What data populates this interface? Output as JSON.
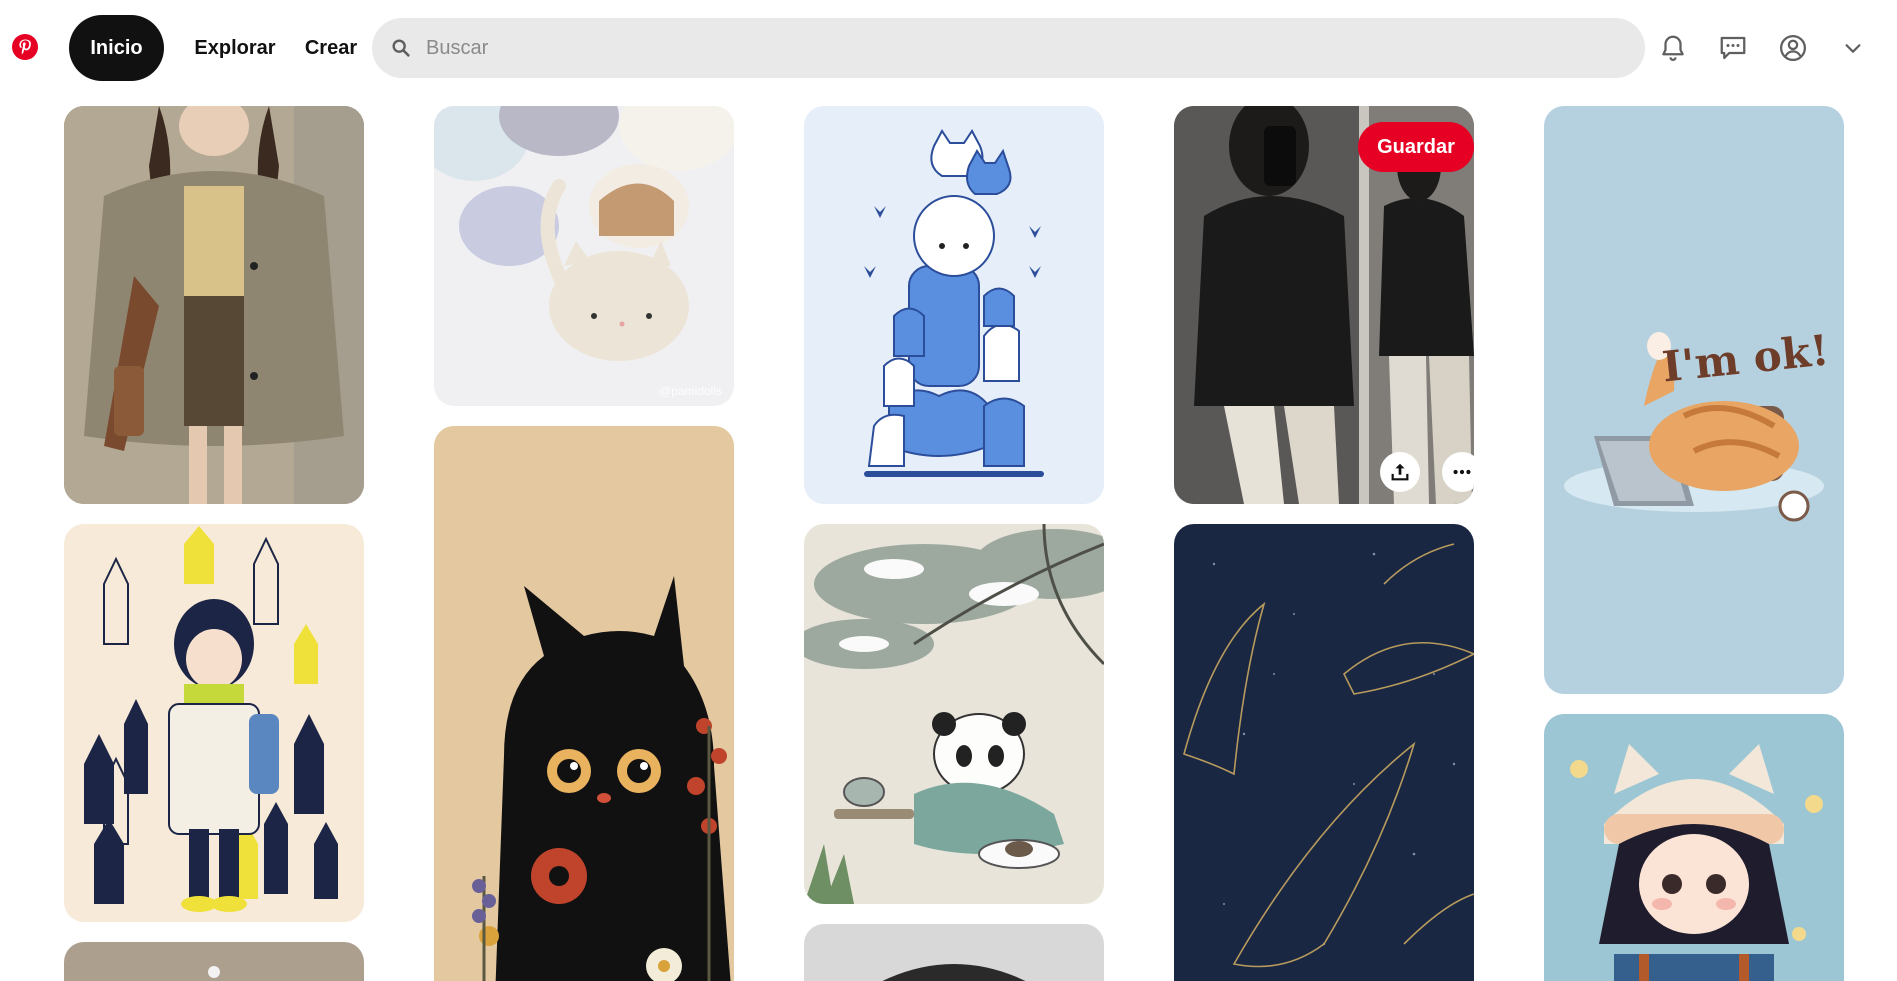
{
  "app": {
    "brand": "Pinterest",
    "accent_color": "#e60023"
  },
  "header": {
    "nav": {
      "home": "Inicio",
      "explore": "Explorar",
      "create": "Crear"
    },
    "search": {
      "placeholder": "Buscar"
    },
    "icons": [
      "pinterest-logo-icon",
      "search-icon",
      "bell-icon",
      "messages-icon",
      "account-icon",
      "chevron-down-icon"
    ]
  },
  "feed": {
    "save_label": "Guardar",
    "pins": [
      {
        "name": "pin-beige-cardigan-outfit",
        "column": 1
      },
      {
        "name": "pin-crochet-cats",
        "column": 2,
        "watermark": "@pamidolls"
      },
      {
        "name": "pin-blue-cat-stack-illustration",
        "column": 3
      },
      {
        "name": "pin-black-outfit-mirror-selfie",
        "column": 4,
        "hovered": true
      },
      {
        "name": "pin-im-ok-cat",
        "column": 5,
        "caption": "I'm ok!"
      },
      {
        "name": "pin-girl-with-black-cats",
        "column": 1
      },
      {
        "name": "pin-black-cat-flowers",
        "column": 2
      },
      {
        "name": "pin-panda-tea-watercolor",
        "column": 3
      },
      {
        "name": "pin-whales-night-sky",
        "column": 4
      },
      {
        "name": "pin-girl-cat-hat",
        "column": 5
      },
      {
        "name": "pin-partial-bottom-col1",
        "column": 1
      },
      {
        "name": "pin-partial-bottom-col3",
        "column": 3
      }
    ]
  }
}
